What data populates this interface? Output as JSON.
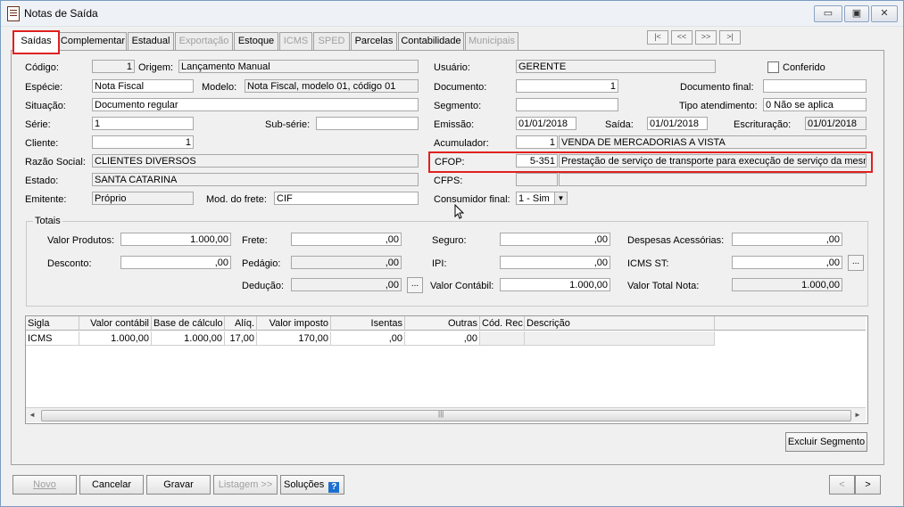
{
  "window": {
    "title": "Notas de Saída",
    "minimize": "▭",
    "restore": "▣",
    "close": "✕"
  },
  "tabs": [
    {
      "label": "Saídas",
      "state": "active"
    },
    {
      "label": "Complementar",
      "state": "enabled"
    },
    {
      "label": "Estadual",
      "state": "enabled"
    },
    {
      "label": "Exportação",
      "state": "disabled"
    },
    {
      "label": "Estoque",
      "state": "enabled"
    },
    {
      "label": "ICMS",
      "state": "disabled"
    },
    {
      "label": "SPED",
      "state": "disabled"
    },
    {
      "label": "Parcelas",
      "state": "enabled"
    },
    {
      "label": "Contabilidade",
      "state": "enabled"
    },
    {
      "label": "Municipais",
      "state": "disabled"
    }
  ],
  "record_nav": [
    "|<",
    "<<",
    ">>",
    ">|"
  ],
  "form": {
    "codigo_label": "Código:",
    "codigo": "1",
    "origem_label": "Origem:",
    "origem": "Lançamento Manual",
    "especie_label": "Espécie:",
    "especie": "Nota Fiscal",
    "modelo_label": "Modelo:",
    "modelo": "Nota Fiscal, modelo 01, código 01",
    "situacao_label": "Situação:",
    "situacao": "Documento regular",
    "serie_label": "Série:",
    "serie": "1",
    "subserie_label": "Sub-série:",
    "subserie": "",
    "cliente_label": "Cliente:",
    "cliente": "1",
    "razao_label": "Razão Social:",
    "razao": "CLIENTES DIVERSOS",
    "estado_label": "Estado:",
    "estado": "SANTA CATARINA",
    "emitente_label": "Emitente:",
    "emitente": "Próprio",
    "frete_label": "Mod. do frete:",
    "frete": "CIF",
    "usuario_label": "Usuário:",
    "usuario": "GERENTE",
    "conferido_label": "Conferido",
    "documento_label": "Documento:",
    "documento": "1",
    "docfinal_label": "Documento final:",
    "docfinal": "",
    "segmento_label": "Segmento:",
    "segmento": "",
    "tipoatend_label": "Tipo atendimento:",
    "tipoatend": "0 Não se aplica",
    "emissao_label": "Emissão:",
    "emissao": "01/01/2018",
    "saida_label": "Saída:",
    "saida": "01/01/2018",
    "escrituracao_label": "Escrituração:",
    "escrituracao": "01/01/2018",
    "acumulador_label": "Acumulador:",
    "acumulador": "1",
    "acumulador_desc": "VENDA DE MERCADORIAS A VISTA",
    "cfop_label": "CFOP:",
    "cfop": "5-351",
    "cfop_desc": "Prestação de serviço de transporte para execução de serviço da mesma",
    "cfps_label": "CFPS:",
    "cfps": "",
    "cfps_desc": "",
    "consumidor_label": "Consumidor final:",
    "consumidor": "1 - Sim"
  },
  "totais": {
    "title": "Totais",
    "valor_produtos_label": "Valor Produtos:",
    "valor_produtos": "1.000,00",
    "desconto_label": "Desconto:",
    "desconto": ",00",
    "frete_label": "Frete:",
    "frete": ",00",
    "pedagio_label": "Pedágio:",
    "pedagio": ",00",
    "deducao_label": "Dedução:",
    "deducao": ",00",
    "seguro_label": "Seguro:",
    "seguro": ",00",
    "ipi_label": "IPI:",
    "ipi": ",00",
    "valor_contabil_label": "Valor Contábil:",
    "valor_contabil": "1.000,00",
    "despesas_label": "Despesas Acessórias:",
    "despesas": ",00",
    "icms_st_label": "ICMS ST:",
    "icms_st": ",00",
    "valor_total_label": "Valor Total Nota:",
    "valor_total": "1.000,00"
  },
  "grid": {
    "headers": [
      "Sigla",
      "Valor contábil",
      "Base de cálculo",
      "Alíq.",
      "Valor imposto",
      "Isentas",
      "Outras",
      "Cód. Rec.",
      "Descrição"
    ],
    "rows": [
      [
        "ICMS",
        "1.000,00",
        "1.000,00",
        "17,00",
        "170,00",
        ",00",
        ",00",
        "",
        ""
      ]
    ],
    "scroll_grip": "|||"
  },
  "buttons": {
    "excluir": "Excluir Segmento",
    "novo": "Novo",
    "cancelar": "Cancelar",
    "gravar": "Gravar",
    "listagem": "Listagem >>",
    "solucoes": "Soluções",
    "help_glyph": "?",
    "prev": "<",
    "next": ">",
    "dots": "..."
  },
  "colors": {
    "highlight": "#e02020",
    "help": "#1e6fd0"
  }
}
